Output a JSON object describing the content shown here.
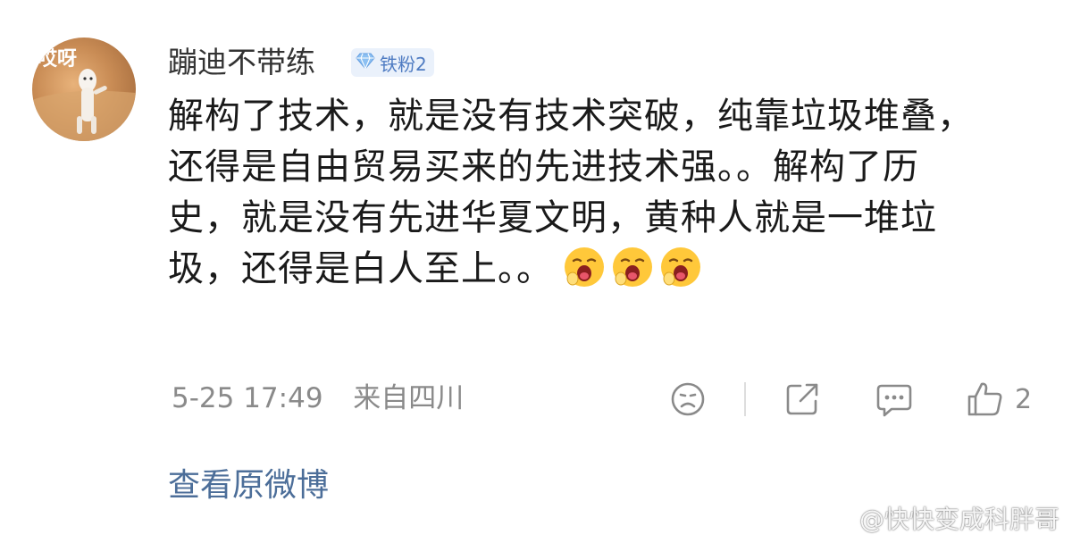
{
  "comment": {
    "avatar_text": "哎呀",
    "username": "蹦迪不带练",
    "badge": {
      "label": "铁粉2",
      "color": "#4e7bc2",
      "icon": "diamond-icon"
    },
    "text_lines": [
      "解构了技术，就是没有技术突破，纯靠垃圾堆叠，",
      "还得是自由贸易买来的先进技术强。。解构了历",
      "史，就是没有先进华夏文明，黄种人就是一堆垃",
      "圾，还得是白人至上。。"
    ],
    "emojis": [
      "yawn-emoji",
      "yawn-emoji",
      "yawn-emoji"
    ],
    "timestamp": "5-25 17:49",
    "location": "来自四川",
    "actions": {
      "dislike_icon": "sad-face-icon",
      "share_icon": "share-icon",
      "reply_icon": "comment-bubble-icon",
      "like_icon": "thumbs-up-icon",
      "like_count": "2"
    },
    "view_link": "查看原微博",
    "link_color": "#4c6e99"
  },
  "watermark": {
    "text": "@快快变成科胖哥",
    "icon": "weibo-icon"
  }
}
